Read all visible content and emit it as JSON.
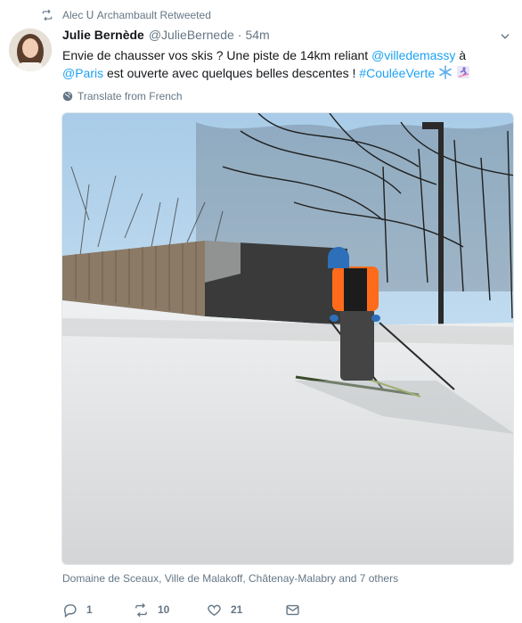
{
  "retweet_context": {
    "text": "Alec ᑌ Archambault Retweeted"
  },
  "tweet": {
    "author_name": "Julie Bernède",
    "author_handle": "@JulieBernede",
    "separator": "·",
    "time": "54m",
    "text_part1": "Envie de chausser vos skis ? Une piste de 14km reliant ",
    "mention1": "@villedemassy",
    "text_part2": " à ",
    "mention2": "@Paris",
    "text_part3": " est ouverte avec quelques belles descentes ! ",
    "hashtag": "#CouléeVerte",
    "translate_label": "Translate from French",
    "location": "Domaine de Sceaux, Ville de Malakoff, Châtenay-Malabry and 7 others"
  },
  "actions": {
    "reply_count": "1",
    "retweet_count": "10",
    "like_count": "21"
  },
  "icons": {
    "retweet": "retweet-icon",
    "caret": "chevron-down-icon",
    "globe": "globe-icon",
    "reply": "reply-icon",
    "like": "heart-icon",
    "message": "envelope-icon",
    "snowflake": "snowflake-emoji",
    "skier": "skier-emoji"
  },
  "colors": {
    "link": "#1da1f2",
    "secondary": "#657786",
    "text": "#14171a"
  }
}
